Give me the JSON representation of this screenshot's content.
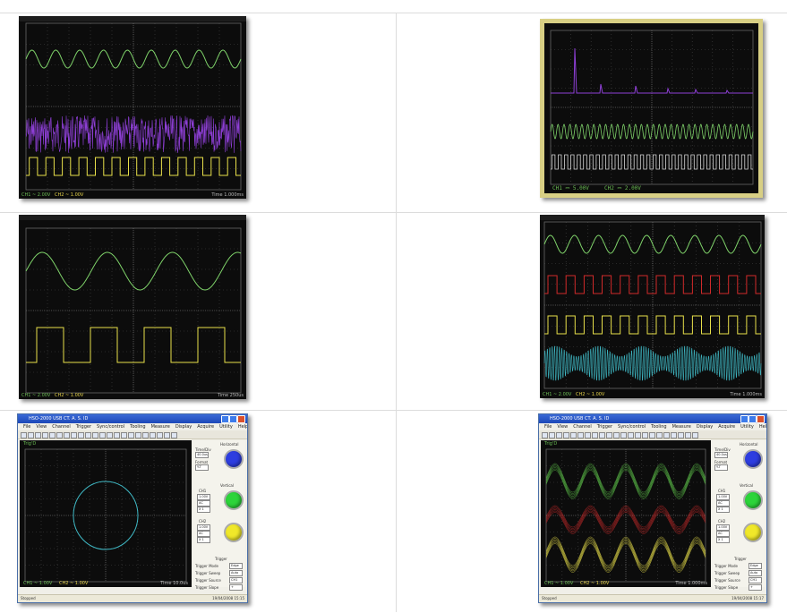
{
  "panels": {
    "p1": {
      "status_left": "CH1 ~ 2.00V",
      "status_mid": "CH2 ~ 1.00V",
      "status_right": "Time 1.000ms"
    },
    "p2": {
      "status_left": "CH1 ⎓ 5.00V",
      "status_right": "CH2 ⎓ 2.00V"
    },
    "p3": {
      "status_left": "CH1 ~ 2.00V",
      "status_mid": "CH2 ~ 1.00V",
      "status_right": "Time 250us"
    },
    "p4": {
      "status_left": "CH1 ~ 2.00V",
      "status_mid": "CH2 ~ 1.00V",
      "status_right": "Time 1.000ms"
    }
  },
  "apps": {
    "title": "HSO-2000 USB CT. A. S. ID",
    "menu": [
      "File",
      "View",
      "Channel",
      "Trigger",
      "Sync/control",
      "Tooling",
      "Measure",
      "Display",
      "Acquire",
      "Utility",
      "Help"
    ],
    "left": {
      "screen_label": "Trig'D",
      "status_ch1": "CH1 ~ 1.00V",
      "status_ch2": "CH2 ~ 1.00V",
      "status_time": "Time 10.0us",
      "status_bottom_left": "Stopped",
      "status_bottom_right": "19/04/2008  15:15"
    },
    "right": {
      "screen_label": "Trig'D",
      "status_ch1": "CH1 ~ 1.00V",
      "status_ch2": "CH2 ~ 1.00V",
      "status_time": "Time 1.000ms",
      "status_bottom_left": "Stopped",
      "status_bottom_right": "19/04/2008  15:17"
    },
    "side": {
      "horizontal": "Horizontal",
      "time_div": "Time/Div",
      "time_val": "40.0us",
      "format": "Format",
      "format_val": "Y-T",
      "vertical": "Vertical",
      "ch1": "CH1",
      "ch2": "CH2",
      "volt1": "1.00V",
      "coupling": "AC",
      "probe": "X 1",
      "trigger": "Trigger",
      "trigger_mode": "Trigger Mode",
      "trigger_mode_val": "Edge",
      "trigger_sweep": "Trigger Sweep",
      "trigger_sweep_val": "Auto",
      "trigger_source": "Trigger Source",
      "trigger_source_val": "CH1",
      "trigger_slope": "Trigger Slope",
      "trigger_slope_val": "+"
    }
  }
}
